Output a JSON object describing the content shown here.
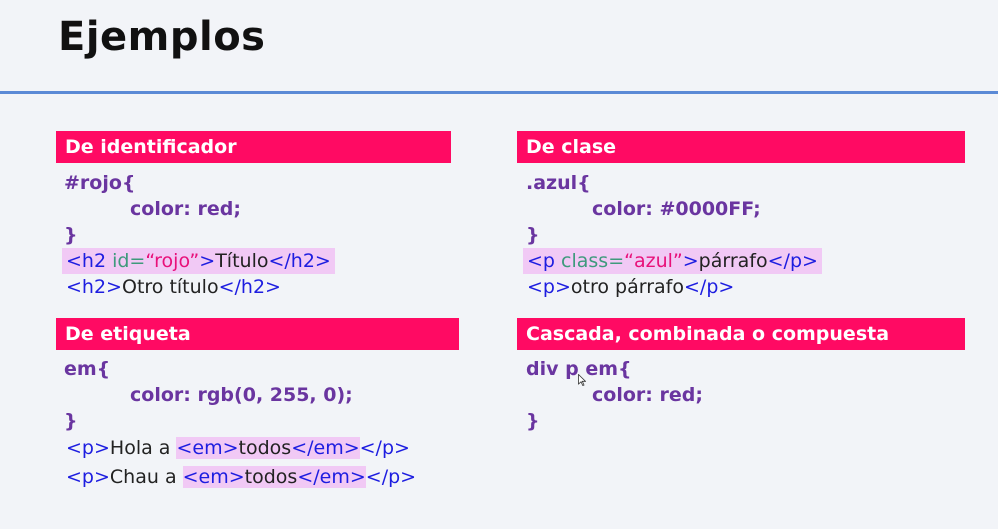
{
  "title": "Ejemplos",
  "sections": {
    "identificador": {
      "header": "De identificador",
      "selector": "#rojo{",
      "declaration": "color: red;",
      "close": "}",
      "ex1": {
        "open_tag": "<h2 ",
        "attr": "id=",
        "value": "“rojo”",
        "gt": ">",
        "text": "Título",
        "close_tag": "</h2>"
      },
      "ex2": {
        "open_tag": "<h2>",
        "text": "Otro título",
        "close_tag": "</h2>"
      }
    },
    "clase": {
      "header": "De clase",
      "selector": ".azul{",
      "declaration": "color: #0000FF;",
      "close": "}",
      "ex1": {
        "open_tag": "<p ",
        "attr": "class=",
        "value": "“azul”",
        "gt": ">",
        "text": "párrafo",
        "close_tag": "</p>"
      },
      "ex2": {
        "open_tag": "<p>",
        "text": "otro párrafo",
        "close_tag": "</p>"
      }
    },
    "etiqueta": {
      "header": "De etiqueta",
      "selector": "em{",
      "declaration": "color: rgb(0, 255, 0);",
      "close": "}",
      "ex1": {
        "p_open": "<p>",
        "text": "Hola a ",
        "em_open": "<em>",
        "em_text": "todos",
        "em_close": "</em>",
        "p_close": "</p>"
      },
      "ex2": {
        "p_open": "<p>",
        "text": "Chau a ",
        "em_open": "<em>",
        "em_text": "todos",
        "em_close": "</em>",
        "p_close": "</p>"
      }
    },
    "cascada": {
      "header": "Cascada, combinada o compuesta",
      "selector": "div p em{",
      "declaration": "color: red;",
      "close": "}"
    }
  },
  "colors": {
    "header_bg": "#ff0a63",
    "rule": "#5b8ad6",
    "code_purple": "#6a35a0",
    "tag_blue": "#1d1de0",
    "highlight": "#f1c9f5"
  }
}
